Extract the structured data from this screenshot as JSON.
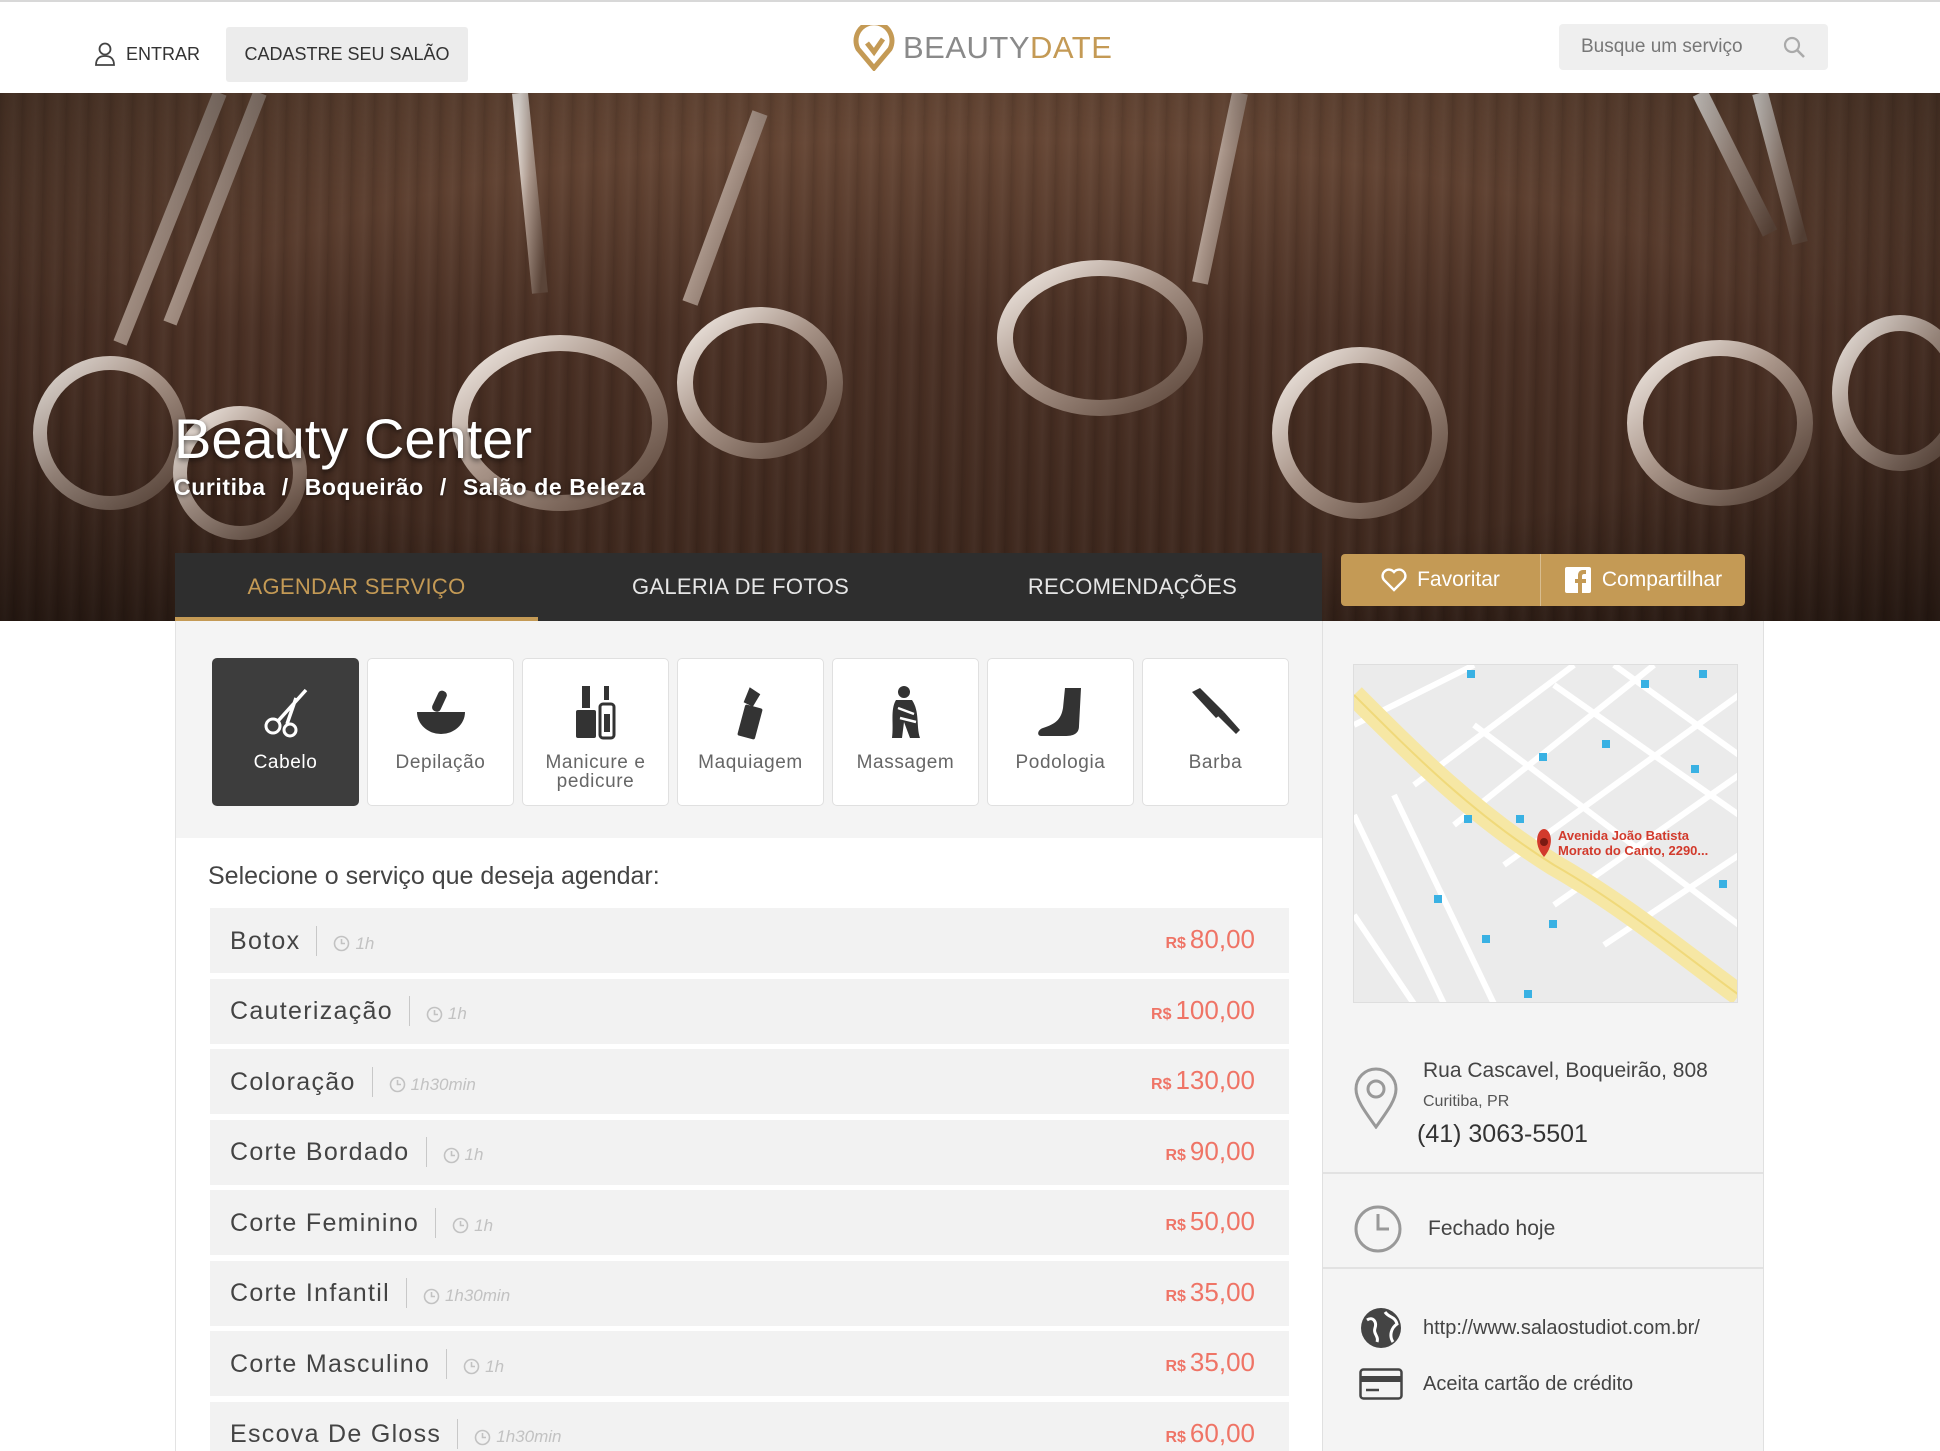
{
  "header": {
    "login_label": "ENTRAR",
    "signup_label": "CADASTRE SEU SALÃO",
    "logo_part1": "BEAUTY",
    "logo_part2": "DATE",
    "search_placeholder": "Busque um serviço"
  },
  "salon": {
    "name": "Beauty Center",
    "breadcrumb": [
      "Curitiba",
      "/",
      "Boqueirão",
      "/",
      "Salão de Beleza"
    ]
  },
  "tabs": [
    {
      "label": "AGENDAR SERVIÇO",
      "active": true
    },
    {
      "label": "GALERIA DE FOTOS",
      "active": false
    },
    {
      "label": "RECOMENDAÇÕES",
      "active": false
    }
  ],
  "actions": {
    "favorite_label": "Favoritar",
    "share_label": "Compartilhar"
  },
  "categories": [
    {
      "label": "Cabelo",
      "icon": "scissors-icon",
      "active": true
    },
    {
      "label": "Depilação",
      "icon": "wax-bowl-icon",
      "active": false
    },
    {
      "label": "Manicure e pedicure",
      "icon": "nail-polish-icon",
      "active": false
    },
    {
      "label": "Maquiagem",
      "icon": "lipstick-icon",
      "active": false
    },
    {
      "label": "Massagem",
      "icon": "massage-icon",
      "active": false
    },
    {
      "label": "Podologia",
      "icon": "foot-icon",
      "active": false
    },
    {
      "label": "Barba",
      "icon": "razor-icon",
      "active": false
    }
  ],
  "services_title": "Selecione o serviço que deseja agendar:",
  "currency": "R$",
  "services": [
    {
      "name": "Botox",
      "duration": "1h",
      "price": "80,00"
    },
    {
      "name": "Cauterização",
      "duration": "1h",
      "price": "100,00"
    },
    {
      "name": "Coloração",
      "duration": "1h30min",
      "price": "130,00"
    },
    {
      "name": "Corte Bordado",
      "duration": "1h",
      "price": "90,00"
    },
    {
      "name": "Corte Feminino",
      "duration": "1h",
      "price": "50,00"
    },
    {
      "name": "Corte Infantil",
      "duration": "1h30min",
      "price": "35,00"
    },
    {
      "name": "Corte Masculino",
      "duration": "1h",
      "price": "35,00"
    },
    {
      "name": "Escova De Gloss",
      "duration": "1h30min",
      "price": "60,00"
    }
  ],
  "sidebar": {
    "map_label": "Avenida João Batista Morato do Canto, 2290...",
    "street": "Rua Cascavel, Boqueirão, 808",
    "city": "Curitiba, PR",
    "phone": "(41) 3063-5501",
    "hours": "Fechado hoje",
    "website": "http://www.salaostudiot.com.br/",
    "payment": "Aceita cartão de crédito"
  },
  "colors": {
    "accent": "#c49a55",
    "dark": "#2e2e2e",
    "price": "#ef7466"
  }
}
